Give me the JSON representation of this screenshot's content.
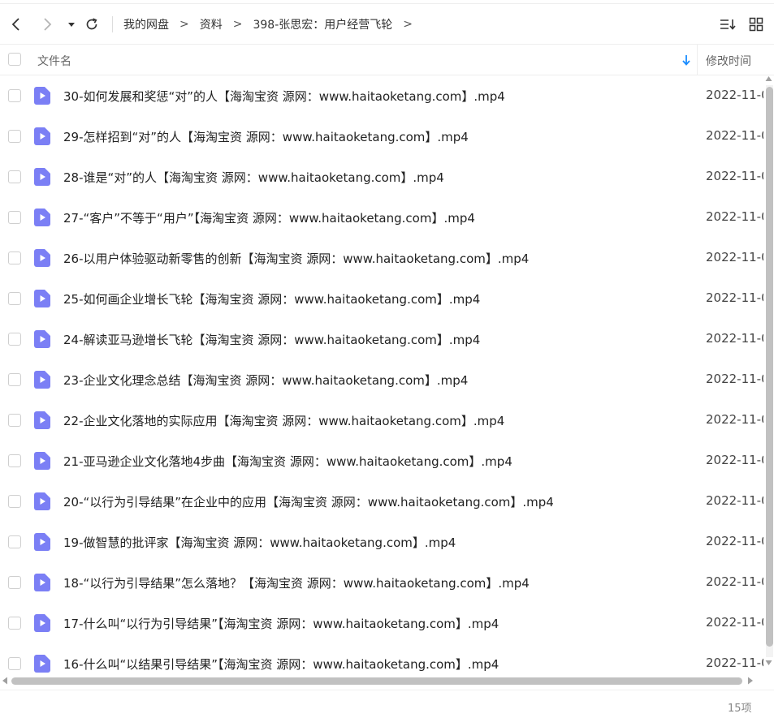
{
  "breadcrumb": [
    "我的网盘",
    "资料",
    "398-张思宏：用户经营飞轮"
  ],
  "crumb_separator": ">",
  "header": {
    "name_label": "文件名",
    "time_label": "修改时间"
  },
  "files": [
    {
      "name": "30-如何发展和奖惩“对”的人【海淘宝资 源网：www.haitaoketang.com】.mp4",
      "time": "2022-11-0"
    },
    {
      "name": "29-怎样招到“对”的人【海淘宝资 源网：www.haitaoketang.com】.mp4",
      "time": "2022-11-0"
    },
    {
      "name": "28-谁是“对”的人【海淘宝资 源网：www.haitaoketang.com】.mp4",
      "time": "2022-11-0"
    },
    {
      "name": "27-“客户”不等于“用户”【海淘宝资 源网：www.haitaoketang.com】.mp4",
      "time": "2022-11-0"
    },
    {
      "name": "26-以用户体验驱动新零售的创新【海淘宝资 源网：www.haitaoketang.com】.mp4",
      "time": "2022-11-0"
    },
    {
      "name": "25-如何画企业增长飞轮【海淘宝资 源网：www.haitaoketang.com】.mp4",
      "time": "2022-11-0"
    },
    {
      "name": "24-解读亚马逊增长飞轮【海淘宝资 源网：www.haitaoketang.com】.mp4",
      "time": "2022-11-0"
    },
    {
      "name": "23-企业文化理念总结【海淘宝资 源网：www.haitaoketang.com】.mp4",
      "time": "2022-11-0"
    },
    {
      "name": "22-企业文化落地的实际应用【海淘宝资 源网：www.haitaoketang.com】.mp4",
      "time": "2022-11-0"
    },
    {
      "name": "21-亚马逊企业文化落地4步曲【海淘宝资 源网：www.haitaoketang.com】.mp4",
      "time": "2022-11-0"
    },
    {
      "name": "20-“以行为引导结果”在企业中的应用【海淘宝资 源网：www.haitaoketang.com】.mp4",
      "time": "2022-11-0"
    },
    {
      "name": "19-做智慧的批评家【海淘宝资 源网：www.haitaoketang.com】.mp4",
      "time": "2022-11-0"
    },
    {
      "name": "18-“以行为引导结果”怎么落地？【海淘宝资 源网：www.haitaoketang.com】.mp4",
      "time": "2022-11-0"
    },
    {
      "name": "17-什么叫“以行为引导结果”【海淘宝资 源网：www.haitaoketang.com】.mp4",
      "time": "2022-11-0"
    },
    {
      "name": "16-什么叫“以结果引导结果”【海淘宝资 源网：www.haitaoketang.com】.mp4",
      "time": "2022-11-0"
    }
  ],
  "item_count": "15项",
  "colors": {
    "accent": "#1a8cff",
    "file_icon": "#7b7ff5",
    "scroll_thumb": "#c1c1c1"
  },
  "icons": {
    "back": "chevron-left-icon",
    "forward": "chevron-right-icon",
    "history": "caret-down-icon",
    "refresh": "refresh-icon",
    "sort": "sort-list-icon",
    "grid": "grid-view-icon",
    "sort_arrow": "arrow-down-icon",
    "file": "video-file-icon"
  }
}
